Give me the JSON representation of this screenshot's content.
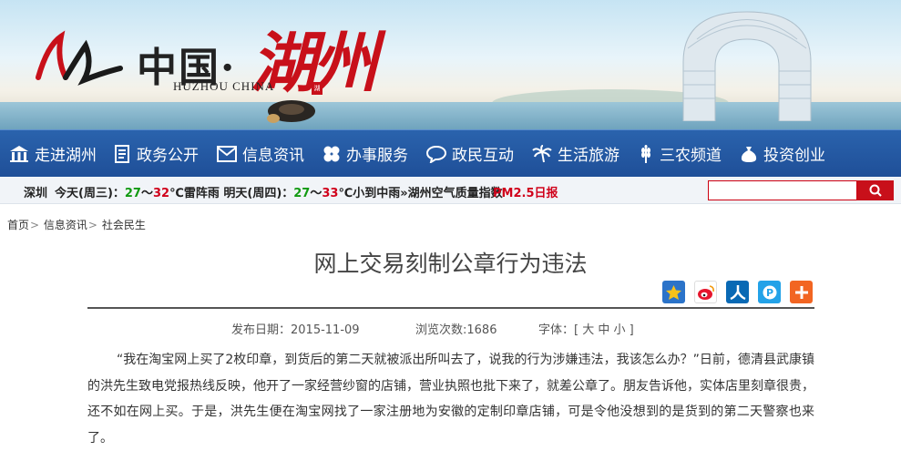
{
  "banner": {
    "title_cn": "中国·",
    "title_huzhou": "湖州",
    "title_en": "HUZHOU CHINA",
    "seal_text": "湖"
  },
  "nav": {
    "items": [
      {
        "label": "走进湖州",
        "icon": "building-icon"
      },
      {
        "label": "政务公开",
        "icon": "document-icon"
      },
      {
        "label": "信息资讯",
        "icon": "mail-icon"
      },
      {
        "label": "办事服务",
        "icon": "clover-icon"
      },
      {
        "label": "政民互动",
        "icon": "chat-icon"
      },
      {
        "label": "生活旅游",
        "icon": "palm-tree-icon"
      },
      {
        "label": "三农频道",
        "icon": "wheat-icon"
      },
      {
        "label": "投资创业",
        "icon": "money-bag-icon"
      }
    ]
  },
  "weather": {
    "city": "深圳",
    "today_label": "今天(周三)：",
    "today_low": "27",
    "today_sep": "～",
    "today_high": "32",
    "today_desc": "℃雷阵雨",
    "tomorrow_label": "明天(周四)：",
    "tomorrow_low": "27",
    "tomorrow_sep": "～",
    "tomorrow_high": "33",
    "tomorrow_desc": "℃小到中雨",
    "aqi_link": "»湖州空气质量指数",
    "pm_link": "PM2.5日报"
  },
  "search": {
    "placeholder": ""
  },
  "breadcrumb": {
    "home": "首页",
    "sep": ">",
    "level1": "信息资讯",
    "level2": "社会民生"
  },
  "article": {
    "title": "网上交易刻制公章行为违法",
    "publish_date": "发布日期：2015-11-09",
    "views": "浏览次数:1686",
    "font_size": "字体：[ 大 中 小 ]",
    "body": "“我在淘宝网上买了2枚印章，到货后的第二天就被派出所叫去了，说我的行为涉嫌违法，我该怎么办？”日前，德清县武康镇的洪先生致电党报热线反映，他开了一家经营纱窗的店铺，营业执照也批下来了，就差公章了。朋友告诉他，实体店里刻章很贵，还不如在网上买。于是，洪先生便在淘宝网找了一家注册地为安徽的定制印章店铺，可是令他没想到的是货到的第二天警察也来了。"
  },
  "share_icons": [
    "qzone-star-icon",
    "weibo-icon",
    "renren-icon",
    "pengyou-icon",
    "more-plus-icon"
  ],
  "colors": {
    "nav_bg": "#2a63ad",
    "accent_red": "#c8101a",
    "temp_green": "#129a12"
  }
}
